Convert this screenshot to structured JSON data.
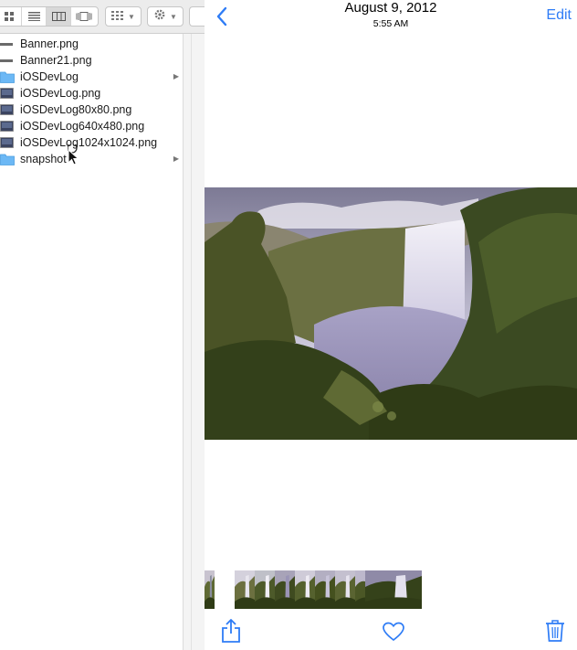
{
  "finder": {
    "toolbar": {
      "view_modes": [
        "icon-view-icon",
        "list-view-icon",
        "column-view-icon",
        "cover-flow-icon"
      ],
      "active_view": "column-view-icon",
      "arrange_icon": "arrange-grid-icon",
      "action_icon": "gear-icon"
    },
    "files": [
      {
        "name": "Banner.png",
        "icon": "image-file-icon",
        "folder": false
      },
      {
        "name": "Banner21.png",
        "icon": "image-file-icon",
        "folder": false
      },
      {
        "name": "iOSDevLog",
        "icon": "folder-icon",
        "folder": true
      },
      {
        "name": "iOSDevLog.png",
        "icon": "image-file-icon",
        "folder": false
      },
      {
        "name": "iOSDevLog80x80.png",
        "icon": "image-file-icon",
        "folder": false
      },
      {
        "name": "iOSDevLog640x480.png",
        "icon": "image-file-icon",
        "folder": false
      },
      {
        "name": "iOSDevLog1024x1024.png",
        "icon": "image-file-icon",
        "folder": false
      },
      {
        "name": "snapshot",
        "icon": "folder-icon",
        "folder": true
      }
    ]
  },
  "photos": {
    "nav": {
      "back_icon": "chevron-left-icon",
      "date": "August 9, 2012",
      "time": "5:55 AM",
      "edit_label": "Edit"
    },
    "thumbnail_count": 9,
    "toolbar": {
      "share_icon": "share-icon",
      "favorite_icon": "heart-icon",
      "delete_icon": "trash-icon"
    },
    "accent_color": "#2e7cf6"
  }
}
